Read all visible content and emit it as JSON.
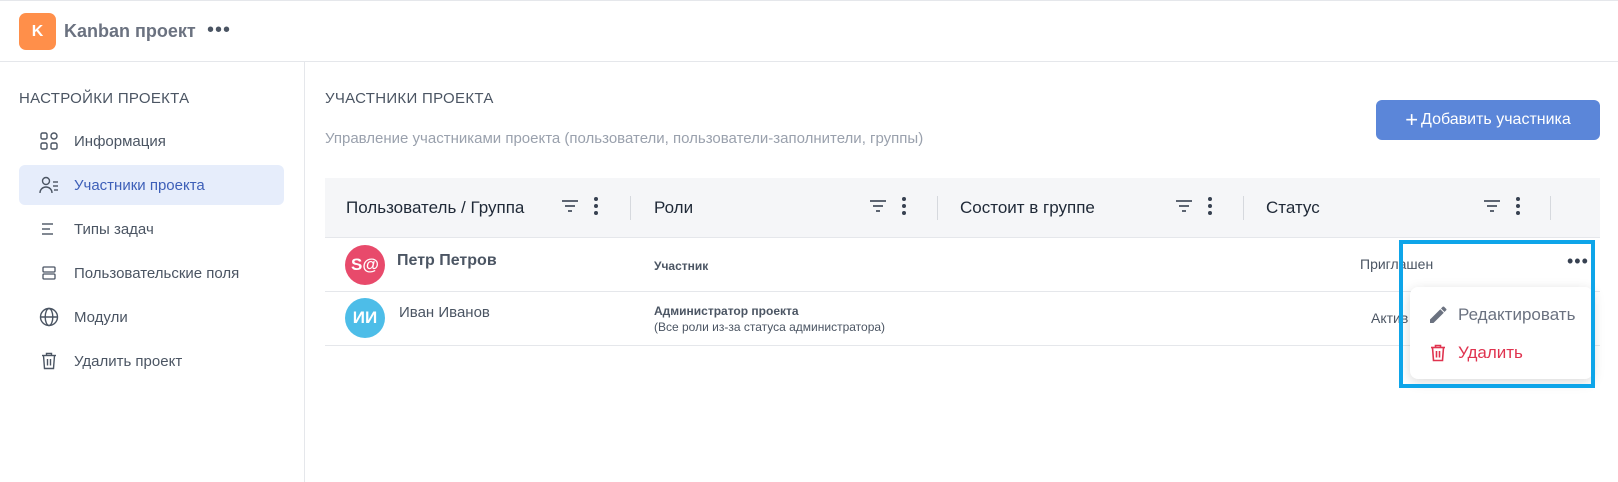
{
  "app": {
    "logo_letter": "K",
    "project_title": "Kanban проект",
    "more_label": "•••"
  },
  "sidebar": {
    "heading": "НАСТРОЙКИ ПРОЕКТА",
    "items": [
      {
        "label": "Информация",
        "icon": "grid-icon",
        "active": false
      },
      {
        "label": "Участники проекта",
        "icon": "users-list-icon",
        "active": true
      },
      {
        "label": "Типы задач",
        "icon": "lines-icon",
        "active": false
      },
      {
        "label": "Пользовательские поля",
        "icon": "fields-icon",
        "active": false
      },
      {
        "label": "Модули",
        "icon": "globe-icon",
        "active": false
      },
      {
        "label": "Удалить проект",
        "icon": "trash-icon",
        "active": false
      }
    ]
  },
  "main": {
    "title": "УЧАСТНИКИ ПРОЕКТА",
    "subtitle": "Управление участниками проекта (пользователи, пользователи-заполнители, группы)",
    "add_button": "Добавить участника",
    "add_button_plus": "+"
  },
  "table": {
    "columns": [
      "Пользователь / Группа",
      "Роли",
      "Состоит в группе",
      "Статус"
    ],
    "rows": [
      {
        "avatar_text": "S@",
        "avatar_color": "#e84a6b",
        "name": "Петр Петров",
        "role": "Участник",
        "role_note": "",
        "status": "Приглашен",
        "more": "•••"
      },
      {
        "avatar_text": "ИИ",
        "avatar_color": "#4dbde8",
        "name": "Иван Иванов",
        "role": "Администратор проекта",
        "role_note": "(Все роли из-за статуса администратора)",
        "status": "Актив",
        "more": ""
      }
    ]
  },
  "context_menu": {
    "edit_label": "Редактировать",
    "delete_label": "Удалить"
  },
  "colors": {
    "accent": "#5b86d9",
    "logo": "#ff8f4a",
    "active_bg": "#e6edfb",
    "delete": "#e0334f",
    "highlight": "#0ea5e9"
  }
}
